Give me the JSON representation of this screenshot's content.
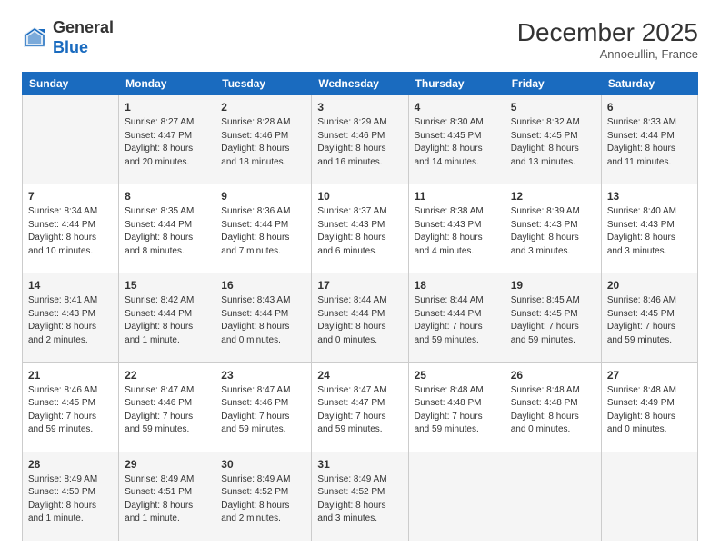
{
  "header": {
    "logo_general": "General",
    "logo_blue": "Blue",
    "month": "December 2025",
    "location": "Annoeullin, France"
  },
  "days": [
    "Sunday",
    "Monday",
    "Tuesday",
    "Wednesday",
    "Thursday",
    "Friday",
    "Saturday"
  ],
  "weeks": [
    [
      {
        "date": "",
        "text": ""
      },
      {
        "date": "1",
        "text": "Sunrise: 8:27 AM\nSunset: 4:47 PM\nDaylight: 8 hours\nand 20 minutes."
      },
      {
        "date": "2",
        "text": "Sunrise: 8:28 AM\nSunset: 4:46 PM\nDaylight: 8 hours\nand 18 minutes."
      },
      {
        "date": "3",
        "text": "Sunrise: 8:29 AM\nSunset: 4:46 PM\nDaylight: 8 hours\nand 16 minutes."
      },
      {
        "date": "4",
        "text": "Sunrise: 8:30 AM\nSunset: 4:45 PM\nDaylight: 8 hours\nand 14 minutes."
      },
      {
        "date": "5",
        "text": "Sunrise: 8:32 AM\nSunset: 4:45 PM\nDaylight: 8 hours\nand 13 minutes."
      },
      {
        "date": "6",
        "text": "Sunrise: 8:33 AM\nSunset: 4:44 PM\nDaylight: 8 hours\nand 11 minutes."
      }
    ],
    [
      {
        "date": "7",
        "text": "Sunrise: 8:34 AM\nSunset: 4:44 PM\nDaylight: 8 hours\nand 10 minutes."
      },
      {
        "date": "8",
        "text": "Sunrise: 8:35 AM\nSunset: 4:44 PM\nDaylight: 8 hours\nand 8 minutes."
      },
      {
        "date": "9",
        "text": "Sunrise: 8:36 AM\nSunset: 4:44 PM\nDaylight: 8 hours\nand 7 minutes."
      },
      {
        "date": "10",
        "text": "Sunrise: 8:37 AM\nSunset: 4:43 PM\nDaylight: 8 hours\nand 6 minutes."
      },
      {
        "date": "11",
        "text": "Sunrise: 8:38 AM\nSunset: 4:43 PM\nDaylight: 8 hours\nand 4 minutes."
      },
      {
        "date": "12",
        "text": "Sunrise: 8:39 AM\nSunset: 4:43 PM\nDaylight: 8 hours\nand 3 minutes."
      },
      {
        "date": "13",
        "text": "Sunrise: 8:40 AM\nSunset: 4:43 PM\nDaylight: 8 hours\nand 3 minutes."
      }
    ],
    [
      {
        "date": "14",
        "text": "Sunrise: 8:41 AM\nSunset: 4:43 PM\nDaylight: 8 hours\nand 2 minutes."
      },
      {
        "date": "15",
        "text": "Sunrise: 8:42 AM\nSunset: 4:44 PM\nDaylight: 8 hours\nand 1 minute."
      },
      {
        "date": "16",
        "text": "Sunrise: 8:43 AM\nSunset: 4:44 PM\nDaylight: 8 hours\nand 0 minutes."
      },
      {
        "date": "17",
        "text": "Sunrise: 8:44 AM\nSunset: 4:44 PM\nDaylight: 8 hours\nand 0 minutes."
      },
      {
        "date": "18",
        "text": "Sunrise: 8:44 AM\nSunset: 4:44 PM\nDaylight: 7 hours\nand 59 minutes."
      },
      {
        "date": "19",
        "text": "Sunrise: 8:45 AM\nSunset: 4:45 PM\nDaylight: 7 hours\nand 59 minutes."
      },
      {
        "date": "20",
        "text": "Sunrise: 8:46 AM\nSunset: 4:45 PM\nDaylight: 7 hours\nand 59 minutes."
      }
    ],
    [
      {
        "date": "21",
        "text": "Sunrise: 8:46 AM\nSunset: 4:45 PM\nDaylight: 7 hours\nand 59 minutes."
      },
      {
        "date": "22",
        "text": "Sunrise: 8:47 AM\nSunset: 4:46 PM\nDaylight: 7 hours\nand 59 minutes."
      },
      {
        "date": "23",
        "text": "Sunrise: 8:47 AM\nSunset: 4:46 PM\nDaylight: 7 hours\nand 59 minutes."
      },
      {
        "date": "24",
        "text": "Sunrise: 8:47 AM\nSunset: 4:47 PM\nDaylight: 7 hours\nand 59 minutes."
      },
      {
        "date": "25",
        "text": "Sunrise: 8:48 AM\nSunset: 4:48 PM\nDaylight: 7 hours\nand 59 minutes."
      },
      {
        "date": "26",
        "text": "Sunrise: 8:48 AM\nSunset: 4:48 PM\nDaylight: 8 hours\nand 0 minutes."
      },
      {
        "date": "27",
        "text": "Sunrise: 8:48 AM\nSunset: 4:49 PM\nDaylight: 8 hours\nand 0 minutes."
      }
    ],
    [
      {
        "date": "28",
        "text": "Sunrise: 8:49 AM\nSunset: 4:50 PM\nDaylight: 8 hours\nand 1 minute."
      },
      {
        "date": "29",
        "text": "Sunrise: 8:49 AM\nSunset: 4:51 PM\nDaylight: 8 hours\nand 1 minute."
      },
      {
        "date": "30",
        "text": "Sunrise: 8:49 AM\nSunset: 4:52 PM\nDaylight: 8 hours\nand 2 minutes."
      },
      {
        "date": "31",
        "text": "Sunrise: 8:49 AM\nSunset: 4:52 PM\nDaylight: 8 hours\nand 3 minutes."
      },
      {
        "date": "",
        "text": ""
      },
      {
        "date": "",
        "text": ""
      },
      {
        "date": "",
        "text": ""
      }
    ]
  ]
}
